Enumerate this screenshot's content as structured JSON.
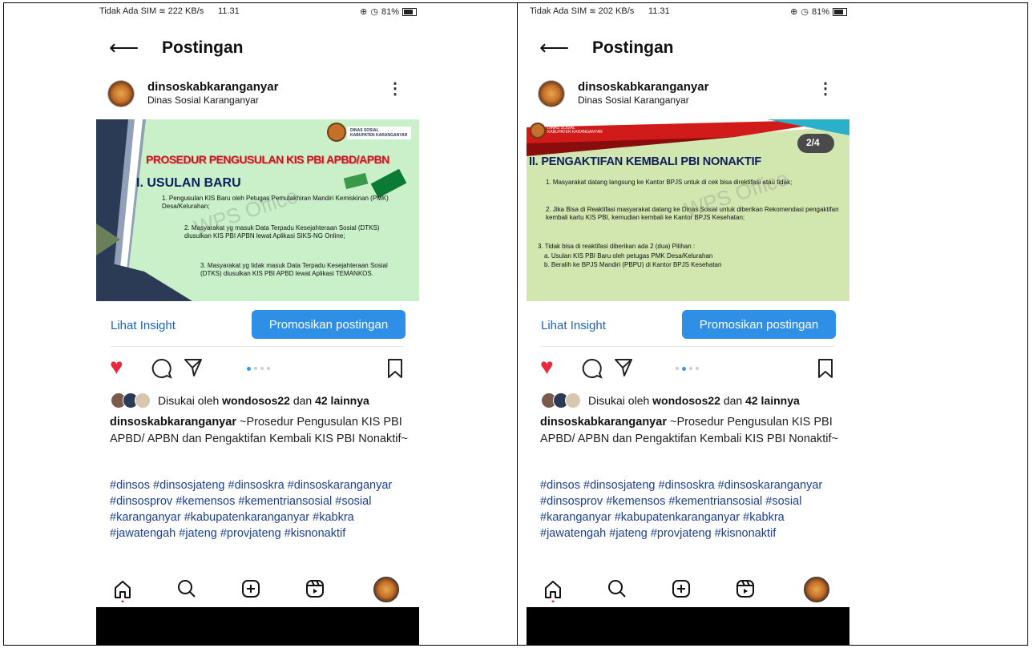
{
  "left": {
    "status": {
      "carrier": "Tidak Ada SIM",
      "speed": "222 KB/s",
      "time": "11.31",
      "battery": "81%"
    },
    "nav_title": "Postingan",
    "user": {
      "name": "dinsoskabkaranganyar",
      "subtitle": "Dinas Sosial Karanganyar"
    },
    "post": {
      "badge_line1": "DINAS SOSIAL",
      "badge_line2": "KABUPATEN KARANGANYAR",
      "title": "PROSEDUR PENGUSULAN KIS PBI APBD/APBN",
      "heading": "I. USULAN BARU",
      "items": [
        "1.  Pengusulan KIS Baru oleh Petugas Pemutakhiran Mandiri Kemiskinan (PMK) Desa/Kelurahan;",
        "2.  Masyarakat yg masuk Data Terpadu Kesejahteraan Sosial (DTKS)  diusulkan KIS PBI APBN lewat Aplikasi SIKS-NG Online;",
        "3.  Masyarakat yg tidak masuk Data Terpadu Kesejahteraan Sosial (DTKS)  diusulkan KIS PBI APBD lewat Aplikasi TEMANKOS."
      ],
      "watermark": "WPS Office"
    },
    "insight": "Lihat Insight",
    "promote": "Promosikan postingan",
    "likes": {
      "prefix": "Disukai oleh",
      "user": "wondosos22",
      "mid": "dan",
      "count": "42 lainnya"
    },
    "caption": {
      "user": "dinsoskabkaranganyar",
      "text": "~Prosedur Pengusulan KIS PBI APBD/ APBN dan Pengaktifan Kembali KIS PBI Nonaktif~"
    },
    "hashtags": "#dinsos #dinsosjateng #dinsoskra #dinsoskaranganyar #dinsosprov #kemensos #kementriansosial #sosial #karanganyar #kabupatenkaranganyar #kabkra #jawatengah #jateng #provjateng #kisnonaktif"
  },
  "right": {
    "status": {
      "carrier": "Tidak Ada SIM",
      "speed": "202 KB/s",
      "time": "11.31",
      "battery": "81%"
    },
    "nav_title": "Postingan",
    "user": {
      "name": "dinsoskabkaranganyar",
      "subtitle": "Dinas Sosial Karanganyar"
    },
    "post": {
      "badge_line1": "DINAS SOSIAL",
      "badge_line2": "KABUPATEN KARANGANYAR",
      "counter": "2/4",
      "heading": "II.  PENGAKTIFAN KEMBALI PBI NONAKTIF",
      "items": [
        "1.  Masyarakat datang langsung ke Kantor BPJS untuk di cek bisa direktifasi atau tidak;",
        "2. Jika Bisa di Reaktifasi masyarakat datang ke Dinas Sosial untuk diberikan Rekomendasi pengaktifan kembali kartu KIS PBI, kemudian kembali ke Kantor BPJS Kesehatan;",
        "3. Tidak bisa di reaktifasi diberikan ada 2 (dua) Pilihan :",
        "a.  Usulan KIS PBI Baru oleh petugas PMK Desa/Kelurahan",
        "b.  Beralih ke BPJS Mandiri (PBPU) di Kantor BPJS Kesehatan"
      ],
      "watermark": "WPS Office"
    },
    "insight": "Lihat Insight",
    "promote": "Promosikan postingan",
    "likes": {
      "prefix": "Disukai oleh",
      "user": "wondosos22",
      "mid": "dan",
      "count": "42 lainnya"
    },
    "caption": {
      "user": "dinsoskabkaranganyar",
      "text": "~Prosedur Pengusulan KIS PBI APBD/ APBN dan Pengaktifan Kembali KIS PBI Nonaktif~"
    },
    "hashtags": "#dinsos #dinsosjateng #dinsoskra #dinsoskaranganyar #dinsosprov #kemensos #kementriansosial #sosial #karanganyar #kabupatenkaranganyar #kabkra #jawatengah #jateng #provjateng #kisnonaktif"
  },
  "colors": {
    "accent": "#2f8fe6",
    "like": "#e8283c",
    "link": "#1d63b5",
    "hashtag": "#1c3f8f"
  }
}
